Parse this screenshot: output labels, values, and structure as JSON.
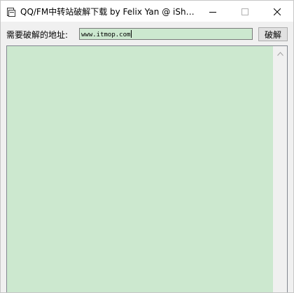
{
  "window": {
    "title": "QQ/FM中转站破解下载 by Felix Yan @ iSh…"
  },
  "form": {
    "address_label": "需要破解的地址:",
    "address_value": "www.itmop.com",
    "crack_button_label": "破解"
  },
  "output": {
    "text": ""
  },
  "icons": {
    "app": "app-window-icon",
    "minimize": "minimize-icon",
    "maximize": "maximize-icon",
    "close": "close-icon",
    "scroll_up": "chevron-up-icon"
  },
  "colors": {
    "input_background": "#cce8cf",
    "window_background": "#f0f0f0"
  }
}
